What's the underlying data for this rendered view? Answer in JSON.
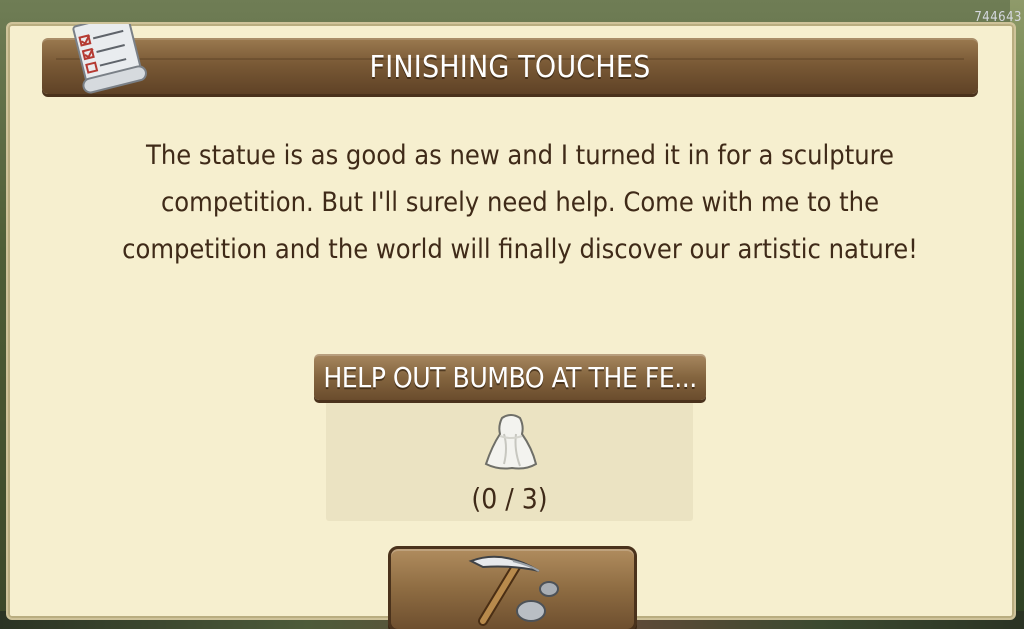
{
  "hud": {
    "player_id": "744643"
  },
  "dialog": {
    "title": "FINISHING TOUCHES",
    "header_icon": "quest-scroll-icon",
    "story": "The statue is as good as new and I turned it in for a sculpture competition. But I'll surely need help. Come with me to the competition and the world will finally discover our artistic nature!",
    "objective": {
      "label": "HELP OUT BUMBO AT THE FE...",
      "item_icon": "white-cloth-icon",
      "progress_text": "(0 / 3)",
      "current": 0,
      "required": 3
    },
    "action_button": {
      "icon": "pickaxe-icon"
    }
  },
  "colors": {
    "parchment": "#f6efcf",
    "wood": "#84653f",
    "text_dark": "#3f2a18",
    "text_light": "#ffffff"
  }
}
